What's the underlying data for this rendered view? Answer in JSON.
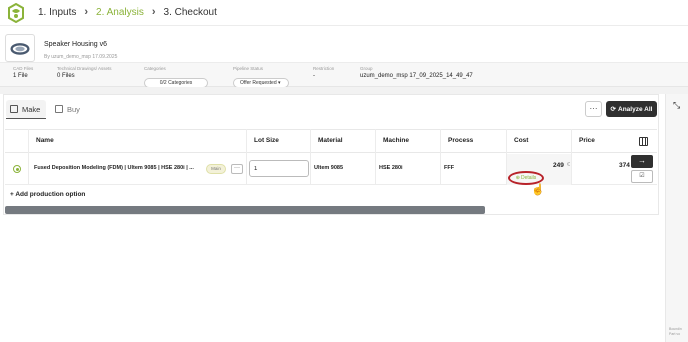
{
  "steps": [
    {
      "label": "1. Inputs",
      "state": "done"
    },
    {
      "label": "2. Analysis",
      "state": "active"
    },
    {
      "label": "3. Checkout",
      "state": "pending"
    }
  ],
  "part": {
    "name": "Speaker Housing v6",
    "byline": "By uzum_demo_msp 17.09.2025"
  },
  "meta": {
    "cad_files_label": "CAD Files",
    "cad_files_value": "1 File",
    "drawings_label": "Technical Drawings/ Assets",
    "drawings_value": "0 Files",
    "categories_label": "Categories",
    "categories_value": "0/2 Categories",
    "pipeline_label": "Pipeline Status",
    "pipeline_value": "Offer Requested",
    "restriction_label": "Restriction",
    "restriction_value": "-",
    "group_label": "Group",
    "group_value": "uzum_demo_msp 17_09_2025_14_49_47"
  },
  "tabs": {
    "make": "Make",
    "buy": "Buy"
  },
  "toolbar": {
    "more": "···",
    "analyze_all": "Analyze All"
  },
  "table": {
    "headers": [
      "Name",
      "Lot Size",
      "Material",
      "Machine",
      "Process",
      "Cost",
      "Price"
    ],
    "row": {
      "name": "Fused Deposition Modeling (FDM) | Ultem 9085 | HSE 280i | ...",
      "badge": "Main",
      "lot_size": "1",
      "material": "Ultem 9085",
      "machine": "HSE 280i",
      "process": "FFF",
      "cost": "249",
      "cost_unit": "€",
      "price": "374",
      "details": "Details"
    },
    "add_production": "+ Add production option"
  },
  "viewer": {
    "caption": "Boundin Part vo"
  },
  "colors": {
    "accent": "#8bb33a",
    "dark_button": "#2f2f2f",
    "highlight": "#b8232a"
  },
  "icons": [
    "logo-icon",
    "chevron-right-icon",
    "factory-icon",
    "cart-icon",
    "refresh-icon",
    "columns-icon",
    "arrow-right-icon",
    "collapse-icon",
    "hand-cursor-icon"
  ]
}
